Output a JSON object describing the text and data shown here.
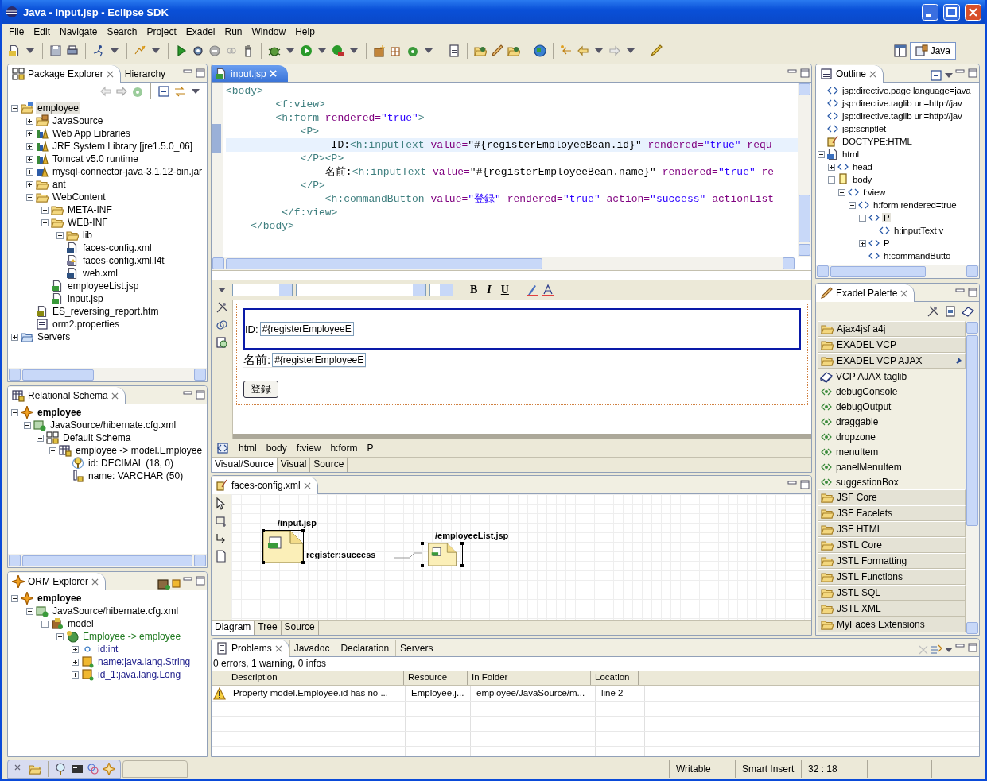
{
  "window": {
    "title": "Java - input.jsp - Eclipse SDK"
  },
  "menu": [
    "File",
    "Edit",
    "Navigate",
    "Search",
    "Project",
    "Exadel",
    "Run",
    "Window",
    "Help"
  ],
  "perspective": {
    "label": "Java",
    "selected": true
  },
  "package_explorer": {
    "tabs": [
      {
        "label": "Package Explorer",
        "selected": true
      },
      {
        "label": "Hierarchy",
        "selected": false
      }
    ],
    "tree": [
      {
        "label": "employee",
        "kind": "project",
        "expanded": true,
        "selected": true,
        "children": [
          {
            "label": "JavaSource",
            "kind": "srcfolder",
            "expanded": false,
            "selected": false
          },
          {
            "label": "Web App Libraries",
            "kind": "library",
            "expanded": false,
            "selected": false
          },
          {
            "label": "JRE System Library [jre1.5.0_06]",
            "kind": "library",
            "expanded": false,
            "selected": false
          },
          {
            "label": "Tomcat v5.0 runtime",
            "kind": "library",
            "expanded": false,
            "selected": false
          },
          {
            "label": "mysql-connector-java-3.1.12-bin.jar",
            "kind": "jar",
            "expanded": false,
            "selected": false
          },
          {
            "label": "ant",
            "kind": "folder",
            "expanded": false,
            "selected": false
          },
          {
            "label": "WebContent",
            "kind": "folder",
            "expanded": true,
            "selected": false,
            "children": [
              {
                "label": "META-INF",
                "kind": "folder",
                "expanded": false,
                "selected": false
              },
              {
                "label": "WEB-INF",
                "kind": "folder",
                "expanded": true,
                "selected": false,
                "children": [
                  {
                    "label": "lib",
                    "kind": "folder",
                    "expanded": false,
                    "selected": false
                  },
                  {
                    "label": "faces-config.xml",
                    "kind": "xml",
                    "selected": false
                  },
                  {
                    "label": "faces-config.xml.l4t",
                    "kind": "l4t",
                    "selected": false
                  },
                  {
                    "label": "web.xml",
                    "kind": "xml",
                    "selected": false
                  }
                ]
              },
              {
                "label": "employeeList.jsp",
                "kind": "jsp",
                "selected": false
              },
              {
                "label": "input.jsp",
                "kind": "jsp",
                "selected": false
              }
            ]
          },
          {
            "label": "ES_reversing_report.htm",
            "kind": "htm",
            "selected": false
          },
          {
            "label": "orm2.properties",
            "kind": "props",
            "selected": false
          }
        ]
      },
      {
        "label": "Servers",
        "kind": "bfolder",
        "expanded": false,
        "selected": false
      }
    ]
  },
  "relational_schema": {
    "tabs": [
      {
        "label": "Relational Schema",
        "selected": true
      }
    ],
    "tree": [
      {
        "label": "employee",
        "kind": "star",
        "expanded": true,
        "children": [
          {
            "label": "JavaSource/hibernate.cfg.xml",
            "kind": "cfg",
            "expanded": true,
            "children": [
              {
                "label": "Default Schema",
                "kind": "schema",
                "expanded": true,
                "children": [
                  {
                    "label": "employee -> model.Employee",
                    "kind": "table",
                    "expanded": true,
                    "children": [
                      {
                        "label": "id: DECIMAL (18, 0)",
                        "kind": "key"
                      },
                      {
                        "label": "name: VARCHAR (50)",
                        "kind": "column"
                      }
                    ]
                  }
                ]
              }
            ]
          }
        ]
      }
    ]
  },
  "orm_explorer": {
    "tabs": [
      {
        "label": "ORM Explorer",
        "selected": true
      }
    ],
    "tree": [
      {
        "label": "employee",
        "kind": "star",
        "expanded": true,
        "children": [
          {
            "label": "JavaSource/hibernate.cfg.xml",
            "kind": "cfg",
            "expanded": true,
            "children": [
              {
                "label": "model",
                "kind": "model",
                "expanded": true,
                "children": [
                  {
                    "label": "Employee -> employee",
                    "kind": "class",
                    "expanded": true,
                    "children": [
                      {
                        "label": "id:int",
                        "kind": "field",
                        "expanded": false
                      },
                      {
                        "label": "name:java.lang.String",
                        "kind": "property",
                        "expanded": false
                      },
                      {
                        "label": "id_1:java.lang.Long",
                        "kind": "property",
                        "expanded": false
                      }
                    ]
                  }
                ]
              }
            ]
          }
        ]
      }
    ]
  },
  "editor": {
    "tabs": [
      {
        "label": "input.jsp",
        "selected": true
      }
    ],
    "source_lines": [
      {
        "current": false,
        "segments": [
          {
            "kind": "tag",
            "text": "<body>"
          }
        ]
      },
      {
        "current": false,
        "segments": [
          {
            "kind": "tag",
            "text": "        <f:view>"
          }
        ]
      },
      {
        "current": false,
        "segments": [
          {
            "kind": "tag",
            "text": "        <h:form "
          },
          {
            "kind": "attr",
            "text": "rendered="
          },
          {
            "kind": "value",
            "text": "\"true\""
          },
          {
            "kind": "tag",
            "text": ">"
          }
        ]
      },
      {
        "current": false,
        "segments": [
          {
            "kind": "tag",
            "text": "            <P>"
          }
        ]
      },
      {
        "current": true,
        "segments": [
          {
            "kind": "text",
            "text": "                 ID:"
          },
          {
            "kind": "tag",
            "text": "<h:inputText "
          },
          {
            "kind": "attr",
            "text": "value="
          },
          {
            "kind": "text",
            "text": "\"#{registerEmployeeBean.id}\" "
          },
          {
            "kind": "attr",
            "text": "rendered="
          },
          {
            "kind": "value",
            "text": "\"true\" "
          },
          {
            "kind": "attr",
            "text": "requ"
          }
        ]
      },
      {
        "current": false,
        "segments": [
          {
            "kind": "tag",
            "text": "            </P><P>"
          }
        ]
      },
      {
        "current": false,
        "segments": [
          {
            "kind": "text",
            "text": "                名前:"
          },
          {
            "kind": "tag",
            "text": "<h:inputText "
          },
          {
            "kind": "attr",
            "text": "value="
          },
          {
            "kind": "text",
            "text": "\"#{registerEmployeeBean.name}\" "
          },
          {
            "kind": "attr",
            "text": "rendered="
          },
          {
            "kind": "value",
            "text": "\"true\" "
          },
          {
            "kind": "attr",
            "text": "re"
          }
        ]
      },
      {
        "current": false,
        "segments": [
          {
            "kind": "tag",
            "text": "            </P>"
          }
        ]
      },
      {
        "current": false,
        "segments": [
          {
            "kind": "tag",
            "text": "                <h:commandButton "
          },
          {
            "kind": "attr",
            "text": "value="
          },
          {
            "kind": "value",
            "text": "\"登録\" "
          },
          {
            "kind": "attr",
            "text": "rendered="
          },
          {
            "kind": "value",
            "text": "\"true\" "
          },
          {
            "kind": "attr",
            "text": "action="
          },
          {
            "kind": "value",
            "text": "\"success\" "
          },
          {
            "kind": "attr",
            "text": "actionList"
          }
        ]
      },
      {
        "current": false,
        "segments": [
          {
            "kind": "tag",
            "text": "         </f:view>"
          }
        ]
      },
      {
        "current": false,
        "segments": [
          {
            "kind": "tag",
            "text": "    </body>"
          }
        ]
      }
    ],
    "format_buttons": [
      "B",
      "I",
      "U"
    ],
    "visual": {
      "id_label": "ID:",
      "id_value": "#{registerEmployeeE",
      "name_label": "名前:",
      "name_value": "#{registerEmployeeE",
      "button": "登録"
    },
    "breadcrumb": [
      "html",
      "body",
      "f:view",
      "h:form",
      "P"
    ],
    "mode_tabs": [
      {
        "label": "Visual/Source",
        "selected": true
      },
      {
        "label": "Visual",
        "selected": false
      },
      {
        "label": "Source",
        "selected": false
      }
    ]
  },
  "faces_config": {
    "tabs": [
      {
        "label": "faces-config.xml",
        "selected": true
      }
    ],
    "nodes": [
      {
        "label": "/input.jsp",
        "selected": true
      },
      {
        "label": "/employeeList.jsp",
        "selected": true
      }
    ],
    "transition": "register:success",
    "mode_tabs": [
      {
        "label": "Diagram",
        "selected": true
      },
      {
        "label": "Tree",
        "selected": false
      },
      {
        "label": "Source",
        "selected": false
      }
    ]
  },
  "outline": {
    "tabs": [
      {
        "label": "Outline",
        "selected": true
      }
    ],
    "tree": [
      {
        "label": "jsp:directive.page language=java",
        "kind": "tag",
        "selected": false
      },
      {
        "label": "jsp:directive.taglib uri=http://jav",
        "kind": "tag",
        "selected": false
      },
      {
        "label": "jsp:directive.taglib uri=http://jav",
        "kind": "tag",
        "selected": false
      },
      {
        "label": "jsp:scriptlet",
        "kind": "tag",
        "selected": false
      },
      {
        "label": "DOCTYPE:HTML",
        "kind": "doctype",
        "selected": false
      },
      {
        "label": "html",
        "kind": "html",
        "expanded": true,
        "selected": false,
        "children": [
          {
            "label": "head",
            "kind": "tag",
            "expanded": false,
            "selected": false
          },
          {
            "label": "body",
            "kind": "body",
            "expanded": true,
            "selected": false,
            "children": [
              {
                "label": "f:view",
                "kind": "tag",
                "expanded": true,
                "selected": false,
                "children": [
                  {
                    "label": "h:form rendered=true",
                    "kind": "tag",
                    "expanded": true,
                    "selected": false,
                    "children": [
                      {
                        "label": "P",
                        "kind": "tag",
                        "expanded": true,
                        "selected": true,
                        "children": [
                          {
                            "label": "h:inputText v",
                            "kind": "tag",
                            "selected": false
                          }
                        ]
                      },
                      {
                        "label": "P",
                        "kind": "tag",
                        "expanded": false,
                        "selected": false
                      },
                      {
                        "label": "h:commandButto",
                        "kind": "tag",
                        "selected": false
                      }
                    ]
                  }
                ]
              }
            ]
          }
        ]
      }
    ]
  },
  "palette": {
    "tabs": [
      {
        "label": "Exadel Palette",
        "selected": true
      }
    ],
    "items": [
      {
        "label": "Ajax4jsf a4j",
        "kind": "group",
        "pinned": false
      },
      {
        "label": "EXADEL VCP",
        "kind": "group",
        "pinned": false
      },
      {
        "label": "EXADEL VCP AJAX",
        "kind": "group",
        "pinned": true
      },
      {
        "label": "VCP AJAX taglib",
        "kind": "taglib"
      },
      {
        "label": "debugConsole",
        "kind": "tag"
      },
      {
        "label": "debugOutput",
        "kind": "tag"
      },
      {
        "label": "draggable",
        "kind": "tag"
      },
      {
        "label": "dropzone",
        "kind": "tag"
      },
      {
        "label": "menuItem",
        "kind": "tag"
      },
      {
        "label": "panelMenuItem",
        "kind": "tag"
      },
      {
        "label": "suggestionBox",
        "kind": "tag"
      },
      {
        "label": "JSF Core",
        "kind": "group",
        "pinned": false
      },
      {
        "label": "JSF Facelets",
        "kind": "group",
        "pinned": false
      },
      {
        "label": "JSF HTML",
        "kind": "group",
        "pinned": false
      },
      {
        "label": "JSTL Core",
        "kind": "group",
        "pinned": false
      },
      {
        "label": "JSTL Formatting",
        "kind": "group",
        "pinned": false
      },
      {
        "label": "JSTL Functions",
        "kind": "group",
        "pinned": false
      },
      {
        "label": "JSTL SQL",
        "kind": "group",
        "pinned": false
      },
      {
        "label": "JSTL XML",
        "kind": "group",
        "pinned": false
      },
      {
        "label": "MyFaces Extensions",
        "kind": "group",
        "pinned": false
      }
    ]
  },
  "problems": {
    "tabs": [
      {
        "label": "Problems",
        "selected": true
      },
      {
        "label": "Javadoc",
        "selected": false
      },
      {
        "label": "Declaration",
        "selected": false
      },
      {
        "label": "Servers",
        "selected": false
      }
    ],
    "summary": "0 errors, 1 warning, 0 infos",
    "columns": [
      "Description",
      "Resource",
      "In Folder",
      "Location"
    ],
    "rows": [
      {
        "kind": "warning",
        "cells": [
          "Property model.Employee.id has no ...",
          "Employee.j...",
          "employee/JavaSource/m...",
          "line 2"
        ]
      }
    ]
  },
  "status_bar": [
    "Writable",
    "Smart Insert",
    "32 : 18"
  ]
}
